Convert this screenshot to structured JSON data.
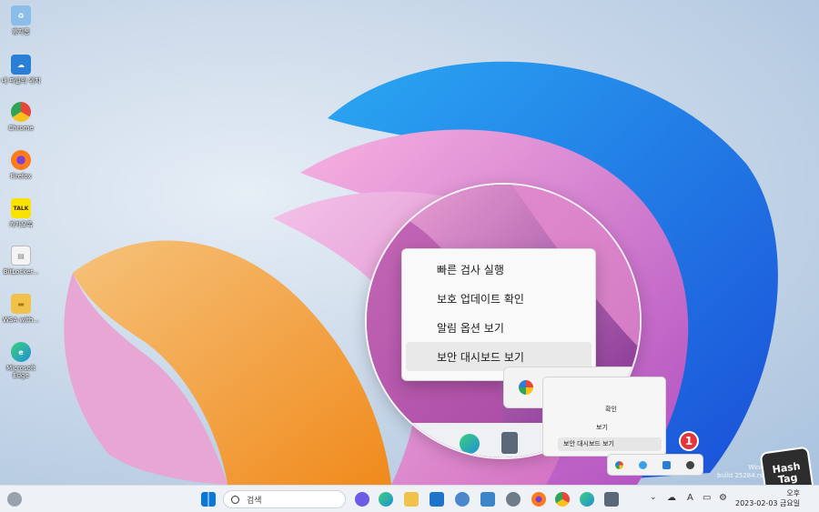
{
  "desktop": {
    "icons": [
      {
        "name": "recycle-bin",
        "label": "휴지통",
        "color": "#7fb7e6",
        "glyph": "♻"
      },
      {
        "name": "onedrive",
        "label": "내 파일의 위치",
        "color": "#2a7fd4",
        "glyph": "☁"
      },
      {
        "name": "chrome",
        "label": "Chrome",
        "color": "#e9463a",
        "glyph": "●"
      },
      {
        "name": "firefox",
        "label": "Firefox",
        "color": "#ff7b1c",
        "glyph": "●"
      },
      {
        "name": "kakaotalk",
        "label": "카카오톡",
        "color": "#f7e200",
        "glyph": "TALK"
      },
      {
        "name": "bitlocker",
        "label": "BitLocker...",
        "color": "#f2f2f2",
        "glyph": "▤"
      },
      {
        "name": "wsa",
        "label": "WSA with...",
        "color": "#f1c24a",
        "glyph": "▬"
      },
      {
        "name": "edge",
        "label": "Microsoft Edge",
        "color": "#1f8fd6",
        "glyph": "e"
      }
    ]
  },
  "context_menu": {
    "items": [
      {
        "label": "빠른 검사 실행"
      },
      {
        "label": "보호 업데이트 확인"
      },
      {
        "label": "알림 옵션 보기"
      },
      {
        "label": "보안 대시보드 보기"
      }
    ]
  },
  "mini_menu": {
    "items": [
      {
        "label": "확인"
      },
      {
        "label": "보기"
      },
      {
        "label": "보안 대시보드 보기"
      }
    ]
  },
  "badge": {
    "number": "1"
  },
  "watermark": {
    "line1": "Windows 11 P",
    "line2": "build 25284.rs_prerelea"
  },
  "hashtag": {
    "line1": "Hash",
    "line2": "Tag"
  },
  "taskbar": {
    "search_placeholder": "검색",
    "tray_lang": "A",
    "clock_time": "오후",
    "clock_date": "2023-02-03 금요일"
  },
  "colors": {
    "accent": "#0067c0",
    "badge": "#e0363c",
    "menu_bg": "#f9f9f9"
  }
}
